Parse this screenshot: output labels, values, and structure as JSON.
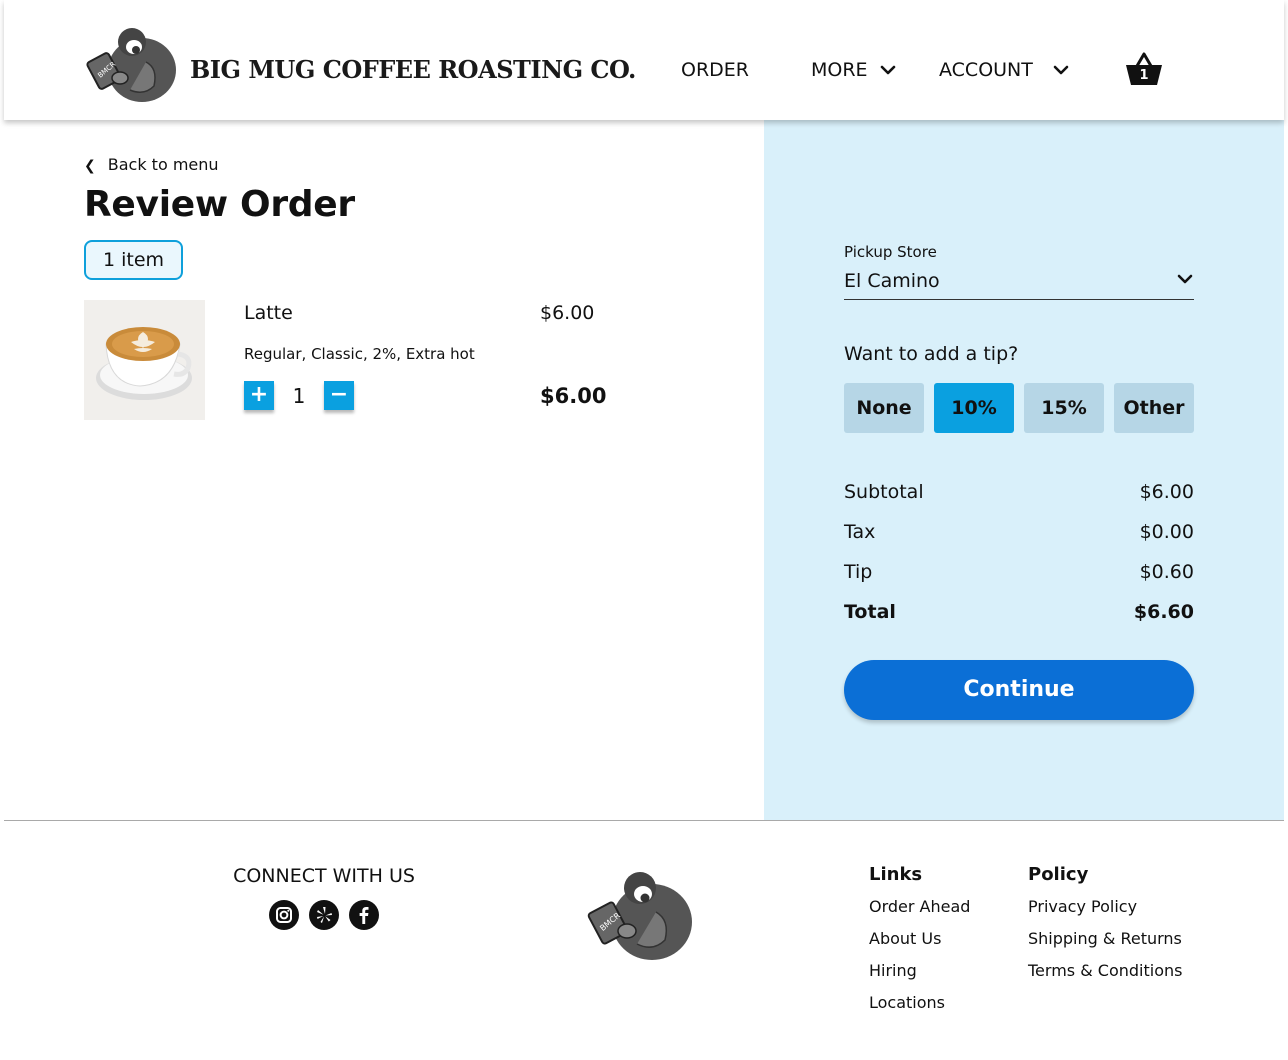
{
  "header": {
    "brand": "BIG MUG COFFEE ROASTING CO.",
    "logo_icon": "gorilla-mug-logo-icon",
    "nav": {
      "order": "ORDER",
      "more": "MORE",
      "account": "ACCOUNT"
    },
    "cart_count": "1"
  },
  "order": {
    "back_link": "Back to menu",
    "title": "Review Order",
    "item_count": "1 item",
    "items": [
      {
        "name": "Latte",
        "price": "$6.00",
        "options": "Regular, Classic, 2%, Extra hot",
        "quantity": "1",
        "line_total": "$6.00",
        "image": "latte-cup-image"
      }
    ],
    "qty_plus": "+",
    "qty_minus": "−"
  },
  "summary": {
    "pickup_label": "Pickup Store",
    "pickup_store": "El Camino",
    "tip_question": "Want to add a tip?",
    "tip_options": [
      "None",
      "10%",
      "15%",
      "Other"
    ],
    "selected_tip": "10%",
    "subtotal_label": "Subtotal",
    "subtotal": "$6.00",
    "tax_label": "Tax",
    "tax": "$0.00",
    "tip_label": "Tip",
    "tip": "$0.60",
    "total_label": "Total",
    "total": "$6.60",
    "continue": "Continue"
  },
  "footer": {
    "connect_title": "CONNECT WITH US",
    "social_icons": [
      "instagram-icon",
      "yelp-icon",
      "facebook-icon"
    ],
    "links_title": "Links",
    "links": [
      "Order Ahead",
      "About Us",
      "Hiring",
      "Locations"
    ],
    "policy_title": "Policy",
    "policy_links": [
      "Privacy Policy",
      "Shipping & Returns",
      "Terms & Conditions"
    ]
  },
  "colors": {
    "accent_blue": "#0aa0e0",
    "continue_blue": "#0b6fd6",
    "panel_bg": "#d9f0fa",
    "tip_button_bg": "#b6d6e6"
  }
}
